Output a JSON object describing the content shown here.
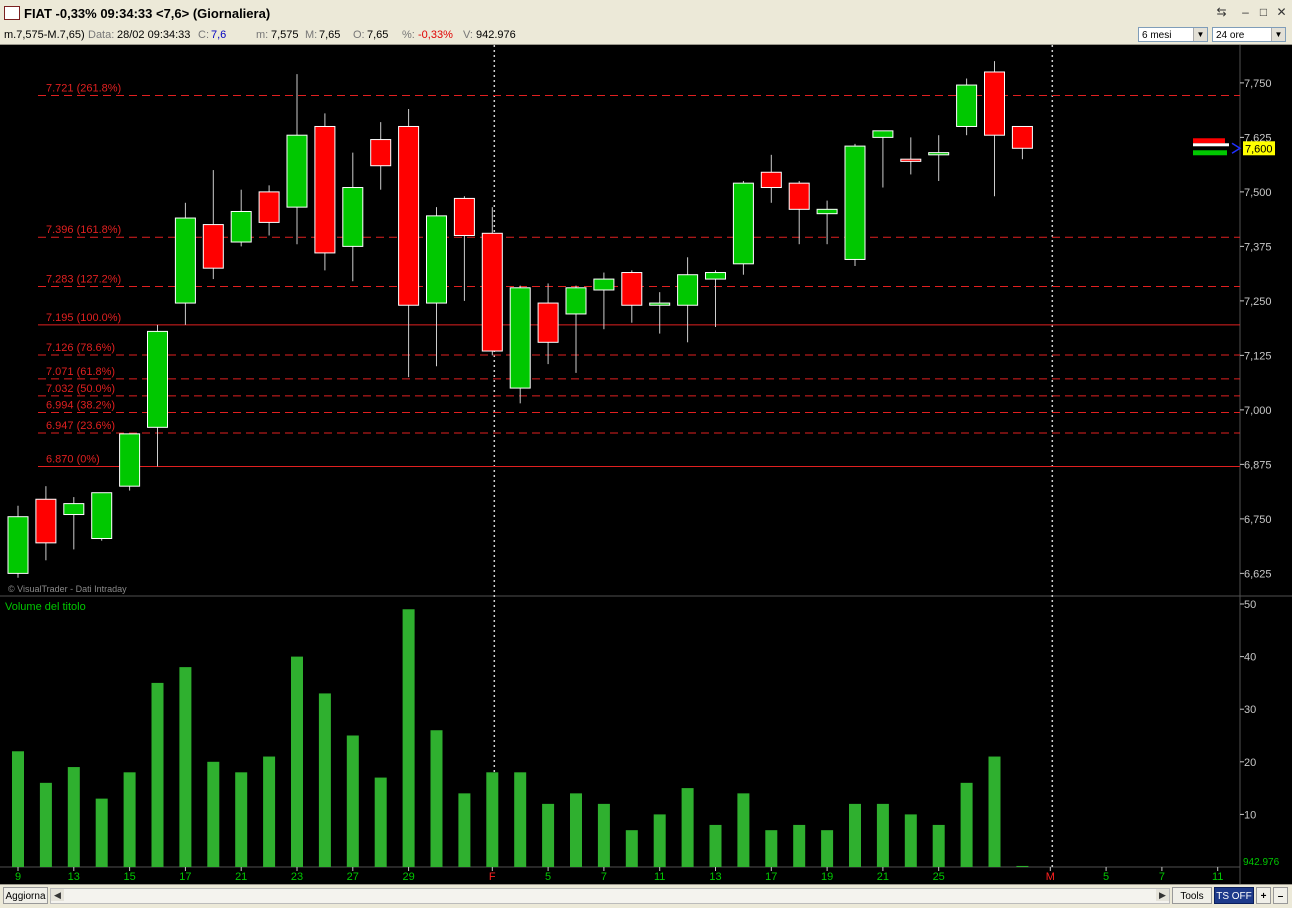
{
  "window": {
    "title": "FIAT -0,33% 09:34:33  <7,6> (Giornaliera)",
    "controls": [
      "⇆",
      "–",
      "□",
      "✕"
    ]
  },
  "infobar": {
    "range": "m.7,575-M.7,65)",
    "data_label": "Data:",
    "data_value": "28/02 09:34:33",
    "c_label": "C:",
    "c_value": "7,6",
    "m_label": "m:",
    "m_value": "7,575",
    "M_label": "M:",
    "M_value": "7,65",
    "o_label": "O:",
    "o_value": "7,65",
    "pct_label": "%:",
    "pct_value": "-0,33%",
    "v_label": "V:",
    "v_value": "942.976",
    "period_select": "6 mesi",
    "interval_select": "24 ore"
  },
  "bottombar": {
    "refresh_button": "Aggiorna",
    "tools_button": "Tools",
    "ts_button": "TS OFF",
    "plus_button": "+",
    "minus_button": "–"
  },
  "chart_data": [
    {
      "type": "candlestick",
      "watermark": "© VisualTrader - Dati Intraday",
      "ylim": [
        6.58,
        7.83
      ],
      "yticks": [
        "7,750",
        "7,625",
        "7,500",
        "7,375",
        "7,250",
        "7,125",
        "7,000",
        "6,875",
        "6,750",
        "6,625"
      ],
      "ytick_values": [
        7.75,
        7.625,
        7.5,
        7.375,
        7.25,
        7.125,
        7.0,
        6.875,
        6.75,
        6.625
      ],
      "last_price_label": "7,600",
      "last_price": 7.6,
      "fib_levels": [
        {
          "label": "7.721 (261.8%)",
          "value": 7.721,
          "style": "dashed"
        },
        {
          "label": "7.396 (161.8%)",
          "value": 7.396,
          "style": "dashed"
        },
        {
          "label": "7.283 (127.2%)",
          "value": 7.283,
          "style": "dashed"
        },
        {
          "label": "7.195 (100.0%)",
          "value": 7.195,
          "style": "solid"
        },
        {
          "label": "7.126 (78.6%)",
          "value": 7.126,
          "style": "dashed"
        },
        {
          "label": "7.071 (61.8%)",
          "value": 7.071,
          "style": "dashed"
        },
        {
          "label": "7.032 (50.0%)",
          "value": 7.032,
          "style": "dashed"
        },
        {
          "label": "6.994 (38.2%)",
          "value": 6.994,
          "style": "dashed"
        },
        {
          "label": "6.947 (23.6%)",
          "value": 6.947,
          "style": "dashed"
        },
        {
          "label": "6.870 (0%)",
          "value": 6.87,
          "style": "solid"
        }
      ],
      "candles": [
        {
          "o": 6.625,
          "h": 6.78,
          "l": 6.615,
          "c": 6.755
        },
        {
          "o": 6.795,
          "h": 6.825,
          "l": 6.655,
          "c": 6.695
        },
        {
          "o": 6.76,
          "h": 6.8,
          "l": 6.68,
          "c": 6.785
        },
        {
          "o": 6.705,
          "h": 6.81,
          "l": 6.7,
          "c": 6.81
        },
        {
          "o": 6.825,
          "h": 6.94,
          "l": 6.815,
          "c": 6.945
        },
        {
          "o": 6.96,
          "h": 7.195,
          "l": 6.87,
          "c": 7.18
        },
        {
          "o": 7.245,
          "h": 7.475,
          "l": 7.195,
          "c": 7.44
        },
        {
          "o": 7.425,
          "h": 7.55,
          "l": 7.3,
          "c": 7.325
        },
        {
          "o": 7.385,
          "h": 7.505,
          "l": 7.375,
          "c": 7.455
        },
        {
          "o": 7.5,
          "h": 7.515,
          "l": 7.4,
          "c": 7.43
        },
        {
          "o": 7.465,
          "h": 7.77,
          "l": 7.38,
          "c": 7.63
        },
        {
          "o": 7.65,
          "h": 7.68,
          "l": 7.32,
          "c": 7.36
        },
        {
          "o": 7.375,
          "h": 7.59,
          "l": 7.295,
          "c": 7.51
        },
        {
          "o": 7.62,
          "h": 7.66,
          "l": 7.505,
          "c": 7.56
        },
        {
          "o": 7.65,
          "h": 7.69,
          "l": 7.075,
          "c": 7.24
        },
        {
          "o": 7.245,
          "h": 7.465,
          "l": 7.1,
          "c": 7.445
        },
        {
          "o": 7.485,
          "h": 7.49,
          "l": 7.25,
          "c": 7.4
        },
        {
          "o": 7.405,
          "h": 7.465,
          "l": 7.125,
          "c": 7.135
        },
        {
          "o": 7.05,
          "h": 7.285,
          "l": 7.015,
          "c": 7.28
        },
        {
          "o": 7.245,
          "h": 7.29,
          "l": 7.105,
          "c": 7.155
        },
        {
          "o": 7.22,
          "h": 7.285,
          "l": 7.085,
          "c": 7.28
        },
        {
          "o": 7.275,
          "h": 7.315,
          "l": 7.185,
          "c": 7.3
        },
        {
          "o": 7.315,
          "h": 7.32,
          "l": 7.2,
          "c": 7.24
        },
        {
          "o": 7.24,
          "h": 7.27,
          "l": 7.175,
          "c": 7.245
        },
        {
          "o": 7.24,
          "h": 7.35,
          "l": 7.155,
          "c": 7.31
        },
        {
          "o": 7.3,
          "h": 7.32,
          "l": 7.19,
          "c": 7.315
        },
        {
          "o": 7.335,
          "h": 7.525,
          "l": 7.31,
          "c": 7.52
        },
        {
          "o": 7.545,
          "h": 7.585,
          "l": 7.475,
          "c": 7.51
        },
        {
          "o": 7.52,
          "h": 7.525,
          "l": 7.38,
          "c": 7.46
        },
        {
          "o": 7.45,
          "h": 7.48,
          "l": 7.38,
          "c": 7.46
        },
        {
          "o": 7.345,
          "h": 7.61,
          "l": 7.33,
          "c": 7.605
        },
        {
          "o": 7.625,
          "h": 7.64,
          "l": 7.51,
          "c": 7.64
        },
        {
          "o": 7.575,
          "h": 7.625,
          "l": 7.54,
          "c": 7.57
        },
        {
          "o": 7.585,
          "h": 7.63,
          "l": 7.525,
          "c": 7.59
        },
        {
          "o": 7.65,
          "h": 7.76,
          "l": 7.63,
          "c": 7.745
        },
        {
          "o": 7.775,
          "h": 7.8,
          "l": 7.49,
          "c": 7.63
        },
        {
          "o": 7.65,
          "h": 7.65,
          "l": 7.575,
          "c": 7.6
        }
      ]
    },
    {
      "type": "bar",
      "title": "Volume del titolo",
      "ylim": [
        0,
        50
      ],
      "yticks": [
        "50",
        "40",
        "30",
        "20",
        "10"
      ],
      "ytick_values": [
        50,
        40,
        30,
        20,
        10
      ],
      "last_volume_label": "942.976",
      "values": [
        22,
        16,
        19,
        13,
        18,
        35,
        38,
        20,
        18,
        21,
        40,
        33,
        25,
        17,
        49,
        26,
        14,
        18,
        18,
        12,
        14,
        12,
        7,
        10,
        15,
        8,
        14,
        7,
        8,
        7,
        12,
        12,
        10,
        8,
        16,
        21,
        0.2
      ]
    }
  ],
  "x_axis": {
    "labels": [
      {
        "text": "9",
        "slot": 0,
        "color": "#00c800"
      },
      {
        "text": "13",
        "slot": 2,
        "color": "#00c800"
      },
      {
        "text": "15",
        "slot": 4,
        "color": "#00c800"
      },
      {
        "text": "17",
        "slot": 6,
        "color": "#00c800"
      },
      {
        "text": "21",
        "slot": 8,
        "color": "#00c800"
      },
      {
        "text": "23",
        "slot": 10,
        "color": "#00c800"
      },
      {
        "text": "27",
        "slot": 12,
        "color": "#00c800"
      },
      {
        "text": "29",
        "slot": 14,
        "color": "#00c800"
      },
      {
        "text": "F",
        "slot": 17,
        "color": "#ff2020"
      },
      {
        "text": "5",
        "slot": 19,
        "color": "#00c800"
      },
      {
        "text": "7",
        "slot": 21,
        "color": "#00c800"
      },
      {
        "text": "11",
        "slot": 23,
        "color": "#00c800"
      },
      {
        "text": "13",
        "slot": 25,
        "color": "#00c800"
      },
      {
        "text": "17",
        "slot": 27,
        "color": "#00c800"
      },
      {
        "text": "19",
        "slot": 29,
        "color": "#00c800"
      },
      {
        "text": "21",
        "slot": 31,
        "color": "#00c800"
      },
      {
        "text": "25",
        "slot": 33,
        "color": "#00c800"
      },
      {
        "text": "M",
        "slot": 37,
        "color": "#ff2020"
      },
      {
        "text": "5",
        "slot": 39,
        "color": "#00c800"
      },
      {
        "text": "7",
        "slot": 41,
        "color": "#00c800"
      },
      {
        "text": "11",
        "slot": 43,
        "color": "#00c800"
      }
    ],
    "month_separators": [
      17,
      37
    ]
  },
  "colors": {
    "up": "#00c800",
    "down": "#ff0000",
    "fib": "#e02020",
    "volume": "#2fb02f",
    "background": "#000000",
    "axis_text": "#c8c8c8"
  }
}
